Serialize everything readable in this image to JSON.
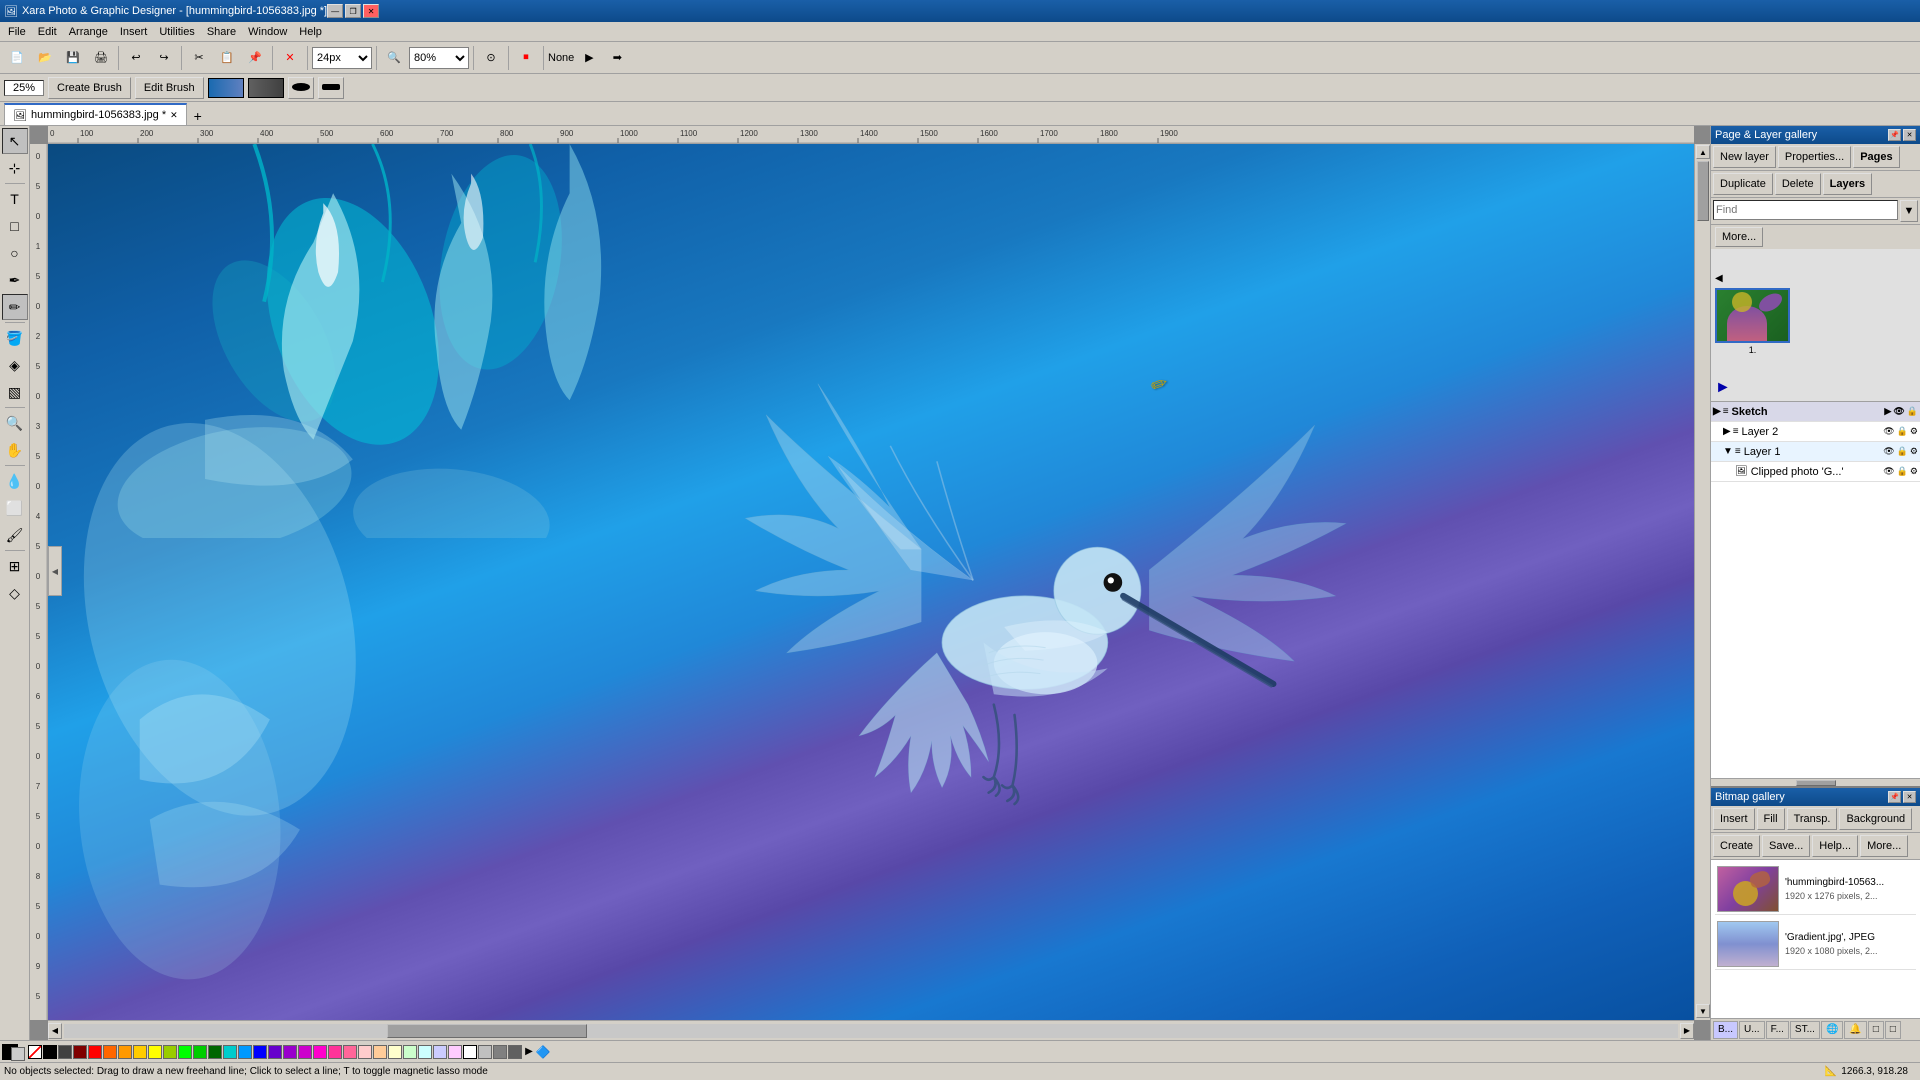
{
  "app": {
    "title": "Xara Photo & Graphic Designer - [hummingbird-1056383.jpg *]",
    "icon": "🖼"
  },
  "titlebar": {
    "title": "Xara Photo & Graphic Designer - [hummingbird-1056383.jpg *]",
    "minimize": "—",
    "restore": "❐",
    "close": "✕"
  },
  "menubar": {
    "items": [
      "File",
      "Edit",
      "Arrange",
      "Insert",
      "Utilities",
      "Share",
      "Window",
      "Help"
    ]
  },
  "toolbar": {
    "zoom_value": "24px",
    "zoom_percent": "80%",
    "items": [
      "new",
      "open",
      "save",
      "print",
      "separator",
      "cut",
      "copy",
      "paste",
      "separator",
      "undo",
      "redo",
      "separator",
      "zoom"
    ]
  },
  "toolbar2": {
    "brush_size_label": "25%",
    "create_brush": "Create Brush",
    "edit_brush": "Edit Brush",
    "opacity_label": "None"
  },
  "tabs": {
    "items": [
      {
        "label": "hummingbird-1056383.jpg *",
        "active": true
      },
      {
        "label": "+",
        "is_add": true
      }
    ]
  },
  "canvas": {
    "filename": "hummingbird-1056383.jpg",
    "zoom": "25%"
  },
  "page_layer_gallery": {
    "title": "Page & Layer gallery",
    "buttons": {
      "new_layer": "New layer",
      "properties": "Properties...",
      "pages_tab": "Pages",
      "duplicate": "Duplicate",
      "delete": "Delete",
      "layers_tab": "Layers",
      "find_label": "Find",
      "more_btn": "More..."
    },
    "page_number": "1.",
    "layers": [
      {
        "name": "Sketch",
        "indent": 0,
        "type": "sketch",
        "icon": "≡"
      },
      {
        "name": "Layer 2",
        "indent": 1,
        "type": "layer",
        "icon": "≡"
      },
      {
        "name": "Layer 1",
        "indent": 1,
        "type": "layer",
        "icon": "≡"
      },
      {
        "name": "Clipped photo 'G...'",
        "indent": 2,
        "type": "item",
        "icon": "🖼"
      }
    ]
  },
  "bitmap_gallery": {
    "title": "Bitmap gallery",
    "buttons": {
      "insert": "Insert",
      "fill": "Fill",
      "transp": "Transp.",
      "background": "Background",
      "create": "Create",
      "save": "Save...",
      "help": "Help...",
      "more": "More..."
    },
    "items": [
      {
        "name": "'hummingbird-10563...",
        "details": "1920 x 1276 pixels, 2...",
        "thumb_type": "hummingbird"
      },
      {
        "name": "'Gradient.jpg',  JPEG",
        "details": "1920 x 1080 pixels, 2...",
        "thumb_type": "gradient"
      }
    ]
  },
  "bottom_panel": {
    "tabs": [
      "B...",
      "U...",
      "F...",
      "ST...",
      "🌐",
      "🔔",
      "⬜",
      "⬜"
    ]
  },
  "statusbar": {
    "message": "No objects selected: Drag to draw a new freehand line; Click to select a line; T to toggle magnetic lasso mode",
    "coords": "1266.3, 918.28"
  },
  "colorbar": {
    "special_colors": [
      "transparent",
      "black",
      "white"
    ],
    "colors": [
      "#000000",
      "#3b3b3b",
      "#7f0000",
      "#ff0000",
      "#ff6600",
      "#ff9900",
      "#ffcc00",
      "#ffff00",
      "#99cc00",
      "#00ff00",
      "#00cc00",
      "#006600",
      "#00cccc",
      "#0099ff",
      "#0000ff",
      "#6600cc",
      "#9900cc",
      "#cc00cc",
      "#ff00cc",
      "#ff3399",
      "#ff6699",
      "#ffcccc",
      "#ffcc99",
      "#ffffcc",
      "#ccffcc",
      "#ccffff",
      "#ccccff",
      "#ffccff",
      "#ffffff",
      "#c0c0c0",
      "#808080",
      "#404040"
    ]
  },
  "panel_pages_layers": {
    "pages_label": "Pages",
    "layers_label": "Layers"
  }
}
